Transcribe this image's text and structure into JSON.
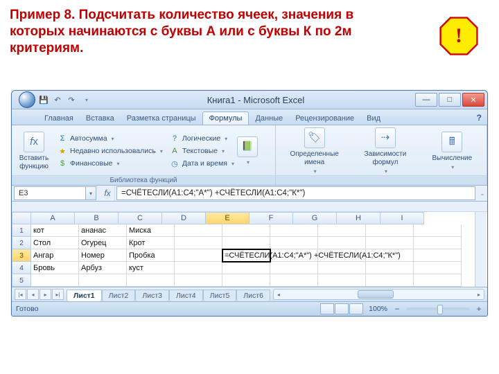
{
  "slide": {
    "title": "Пример 8. Подсчитать количество ячеек,  значения в которых начинаются с буквы А или с буквы К по 2м критериям.",
    "bang": "!"
  },
  "titlebar": {
    "app_title": "Книга1 - Microsoft Excel"
  },
  "ribbon_tabs": [
    "Главная",
    "Вставка",
    "Разметка страницы",
    "Формулы",
    "Данные",
    "Рецензирование",
    "Вид"
  ],
  "ribbon_active_index": 3,
  "ribbon": {
    "group1": {
      "insert_fn": "Вставить функцию",
      "autosum": "Автосумма",
      "recent": "Недавно использовались",
      "financial": "Финансовые",
      "logical": "Логические",
      "text": "Текстовые",
      "datetime": "Дата и время",
      "label": "Библиотека функций"
    },
    "group2": {
      "defined_names": "Определенные имена",
      "trace": "Зависимости формул",
      "calc": "Вычисление"
    }
  },
  "namebox": "E3",
  "formula": "=СЧЁТЕСЛИ(A1:C4;\"А*\") +СЧЁТЕСЛИ(A1:C4;\"К*\")",
  "columns": [
    "A",
    "B",
    "C",
    "D",
    "E",
    "F",
    "G",
    "H",
    "I"
  ],
  "active_col_index": 4,
  "rows": [
    {
      "n": "1",
      "sel": false,
      "cells": [
        "кот",
        "ананас",
        "Миска",
        "",
        "",
        "",
        "",
        "",
        ""
      ]
    },
    {
      "n": "2",
      "sel": false,
      "cells": [
        "Стол",
        "Огурец",
        "Крот",
        "",
        "",
        "",
        "",
        "",
        ""
      ]
    },
    {
      "n": "3",
      "sel": true,
      "cells": [
        "Ангар",
        "Номер",
        "Пробка",
        "",
        "=СЧЁТЕСЛИ(A1:C4;\"А*\") +СЧЁТЕСЛИ(A1:C4;\"К*\")",
        "",
        "",
        "",
        ""
      ]
    },
    {
      "n": "4",
      "sel": false,
      "cells": [
        "Бровь",
        "Арбуз",
        "куст",
        "",
        "",
        "",
        "",
        "",
        ""
      ]
    },
    {
      "n": "5",
      "sel": false,
      "cells": [
        "",
        "",
        "",
        "",
        "",
        "",
        "",
        "",
        ""
      ]
    }
  ],
  "active_cell": {
    "row": 2,
    "col": 4
  },
  "sheet_tabs": [
    "Лист1",
    "Лист2",
    "Лист3",
    "Лист4",
    "Лист5",
    "Лист6"
  ],
  "sheet_active": 0,
  "status": {
    "ready": "Готово",
    "zoom": "100%"
  }
}
